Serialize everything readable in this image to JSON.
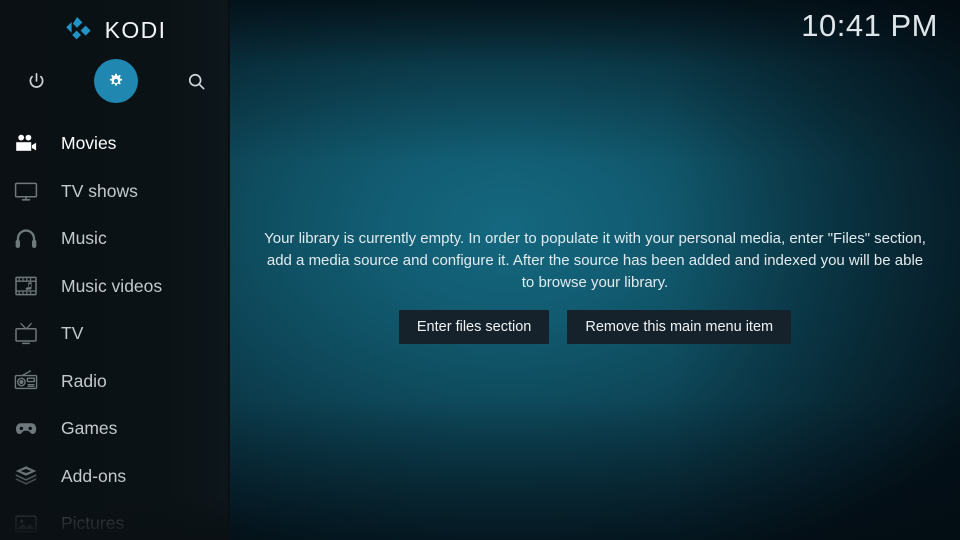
{
  "app": {
    "name": "KODI",
    "logo_icon": "kodi-diamond-logo",
    "accent_color": "#1f87b0",
    "sidebar_bg": "#0a1014",
    "content_bg": "#125d73"
  },
  "clock": {
    "time": "10:41 PM"
  },
  "top_actions": [
    {
      "name": "power",
      "label": "Power",
      "icon": "power-icon",
      "selected": false
    },
    {
      "name": "settings",
      "label": "Settings",
      "icon": "gear-icon",
      "selected": true
    },
    {
      "name": "search",
      "label": "Search",
      "icon": "search-icon",
      "selected": false
    }
  ],
  "sidebar": {
    "items": [
      {
        "label": "Movies",
        "icon": "movie-camera-icon",
        "state": "active"
      },
      {
        "label": "TV shows",
        "icon": "television-icon",
        "state": "normal"
      },
      {
        "label": "Music",
        "icon": "headphones-icon",
        "state": "normal"
      },
      {
        "label": "Music videos",
        "icon": "film-music-icon",
        "state": "normal"
      },
      {
        "label": "TV",
        "icon": "tv-antenna-icon",
        "state": "normal"
      },
      {
        "label": "Radio",
        "icon": "radio-icon",
        "state": "normal"
      },
      {
        "label": "Games",
        "icon": "gamepad-icon",
        "state": "normal"
      },
      {
        "label": "Add-ons",
        "icon": "package-box-icon",
        "state": "normal"
      },
      {
        "label": "Pictures",
        "icon": "picture-icon",
        "state": "dim"
      }
    ]
  },
  "main": {
    "empty_state": {
      "message": "Your library is currently empty. In order to populate it with your personal media, enter \"Files\" section, add a media source and configure it. After the source has been added and indexed you will be able to browse your library.",
      "buttons": [
        {
          "label": "Enter files section"
        },
        {
          "label": "Remove this main menu item"
        }
      ]
    }
  }
}
